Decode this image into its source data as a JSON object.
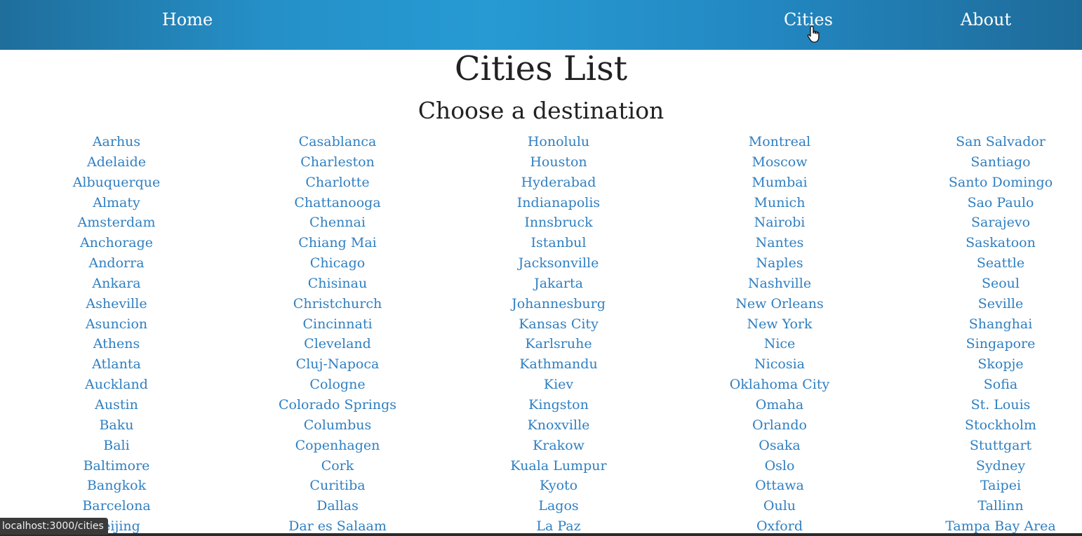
{
  "nav": {
    "home_label": "Home",
    "cities_label": "Cities",
    "about_label": "About"
  },
  "main": {
    "title": "Cities List",
    "subtitle": "Choose a destination"
  },
  "columns": [
    [
      "Aarhus",
      "Adelaide",
      "Albuquerque",
      "Almaty",
      "Amsterdam",
      "Anchorage",
      "Andorra",
      "Ankara",
      "Asheville",
      "Asuncion",
      "Athens",
      "Atlanta",
      "Auckland",
      "Austin",
      "Baku",
      "Bali",
      "Baltimore",
      "Bangkok",
      "Barcelona",
      "Beijing"
    ],
    [
      "Casablanca",
      "Charleston",
      "Charlotte",
      "Chattanooga",
      "Chennai",
      "Chiang Mai",
      "Chicago",
      "Chisinau",
      "Christchurch",
      "Cincinnati",
      "Cleveland",
      "Cluj-Napoca",
      "Cologne",
      "Colorado Springs",
      "Columbus",
      "Copenhagen",
      "Cork",
      "Curitiba",
      "Dallas",
      "Dar es Salaam"
    ],
    [
      "Honolulu",
      "Houston",
      "Hyderabad",
      "Indianapolis",
      "Innsbruck",
      "Istanbul",
      "Jacksonville",
      "Jakarta",
      "Johannesburg",
      "Kansas City",
      "Karlsruhe",
      "Kathmandu",
      "Kiev",
      "Kingston",
      "Knoxville",
      "Krakow",
      "Kuala Lumpur",
      "Kyoto",
      "Lagos",
      "La Paz"
    ],
    [
      "Montreal",
      "Moscow",
      "Mumbai",
      "Munich",
      "Nairobi",
      "Nantes",
      "Naples",
      "Nashville",
      "New Orleans",
      "New York",
      "Nice",
      "Nicosia",
      "Oklahoma City",
      "Omaha",
      "Orlando",
      "Osaka",
      "Oslo",
      "Ottawa",
      "Oulu",
      "Oxford"
    ],
    [
      "San Salvador",
      "Santiago",
      "Santo Domingo",
      "Sao Paulo",
      "Sarajevo",
      "Saskatoon",
      "Seattle",
      "Seoul",
      "Seville",
      "Shanghai",
      "Singapore",
      "Skopje",
      "Sofia",
      "St. Louis",
      "Stockholm",
      "Stuttgart",
      "Sydney",
      "Taipei",
      "Tallinn",
      "Tampa Bay Area"
    ]
  ],
  "status_bar": {
    "url": "localhost:3000/cities"
  },
  "colors": {
    "nav_gradient": "#2590c8",
    "link": "#2f7fc1",
    "heading": "#222222"
  },
  "icons": {
    "cursor": "hand-pointer-icon"
  }
}
